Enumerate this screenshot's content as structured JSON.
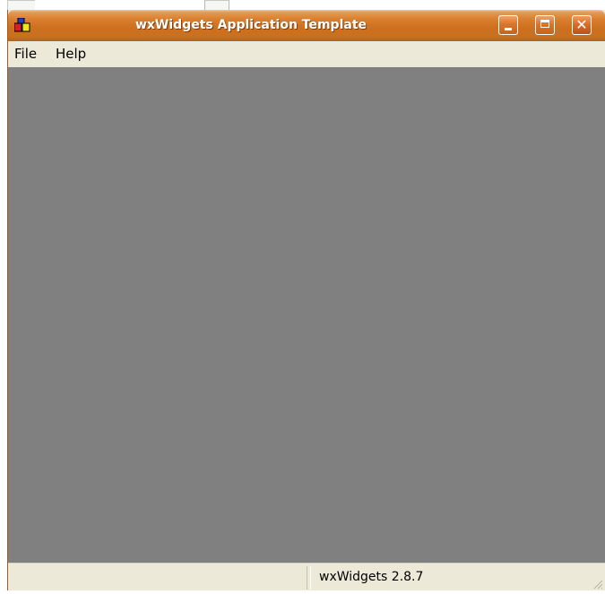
{
  "window": {
    "title": "wxWidgets Application Template",
    "app_icon": "wx-app-icon",
    "controls": {
      "minimize_icon": "minimize-icon",
      "maximize_icon": "maximize-icon",
      "close_glyph": "✕"
    }
  },
  "menu": {
    "items": [
      {
        "label": "File"
      },
      {
        "label": "Help"
      }
    ]
  },
  "statusbar": {
    "fields": [
      "",
      "wxWidgets 2.8.7"
    ]
  },
  "colors": {
    "titlebar": "#d97f2e",
    "client_area": "#808080",
    "chrome": "#ece9d8"
  }
}
